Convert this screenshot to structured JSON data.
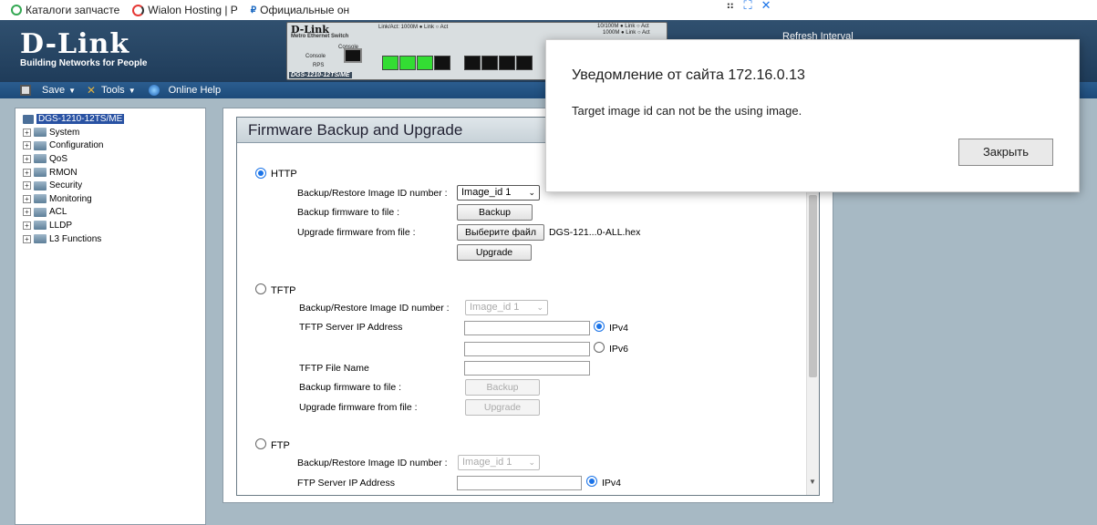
{
  "bookmarks": [
    {
      "label": "Каталоги запчасте",
      "icon": "green-circle-icon",
      "color": "#34a853"
    },
    {
      "label": "Wialon Hosting | Р",
      "icon": "wialon-ring-icon",
      "color": "#e53935"
    },
    {
      "label": "Официальные он",
      "icon": "ruble-icon",
      "color": "#1565c0"
    }
  ],
  "header": {
    "brand": "D-Link",
    "tagline": "Building Networks for People",
    "refresh_label": "Refresh Interval",
    "device": {
      "name": "D-Link",
      "subtitle": "Metro Ethernet Switch",
      "model": "DGS-1210-12TS/ME",
      "led_left": "Link/Act: 1000M ● Link ○ Act",
      "led_right_1": "10/100M ● Link ○ Act",
      "led_right_2": "1000M ● Link ○ Act",
      "console": "Console",
      "console2": "Console",
      "rps": "RPS"
    }
  },
  "toolbar": {
    "save": "Save",
    "tools": "Tools",
    "help": "Online Help"
  },
  "tree": {
    "root": "DGS-1210-12TS/ME",
    "items": [
      "System",
      "Configuration",
      "QoS",
      "RMON",
      "Security",
      "Monitoring",
      "ACL",
      "LLDP",
      "L3 Functions"
    ]
  },
  "panel": {
    "title": "Firmware Backup and Upgrade",
    "http": {
      "label": "HTTP",
      "image_id_label": "Backup/Restore Image ID number :",
      "image_id_value": "Image_id 1",
      "backup_label": "Backup firmware to file :",
      "backup_btn": "Backup",
      "upgrade_label": "Upgrade firmware from file :",
      "choose_btn": "Выберите файл",
      "filename": "DGS-121...0-ALL.hex",
      "upgrade_btn": "Upgrade"
    },
    "tftp": {
      "label": "TFTP",
      "image_id_label": "Backup/Restore Image ID number :",
      "image_id_value": "Image_id 1",
      "server_label": "TFTP Server IP Address",
      "ipv4": "IPv4",
      "ipv6": "IPv6",
      "file_label": "TFTP File Name",
      "backup_label": "Backup firmware to file :",
      "backup_btn": "Backup",
      "upgrade_label": "Upgrade firmware from file :",
      "upgrade_btn": "Upgrade"
    },
    "ftp": {
      "label": "FTP",
      "image_id_label": "Backup/Restore Image ID number :",
      "image_id_value": "Image_id 1",
      "server_label": "FTP Server IP Address",
      "ipv4": "IPv4"
    }
  },
  "dialog": {
    "title": "Уведомление от сайта 172.16.0.13",
    "message": "Target image id can not be the using image.",
    "close_btn": "Закрыть"
  },
  "colors": {
    "header": "#1f3c5a",
    "toolbar": "#1c4a79",
    "background": "#a7b9c4",
    "radio": "#1a73e8",
    "tree_selected": "#2952a3"
  }
}
